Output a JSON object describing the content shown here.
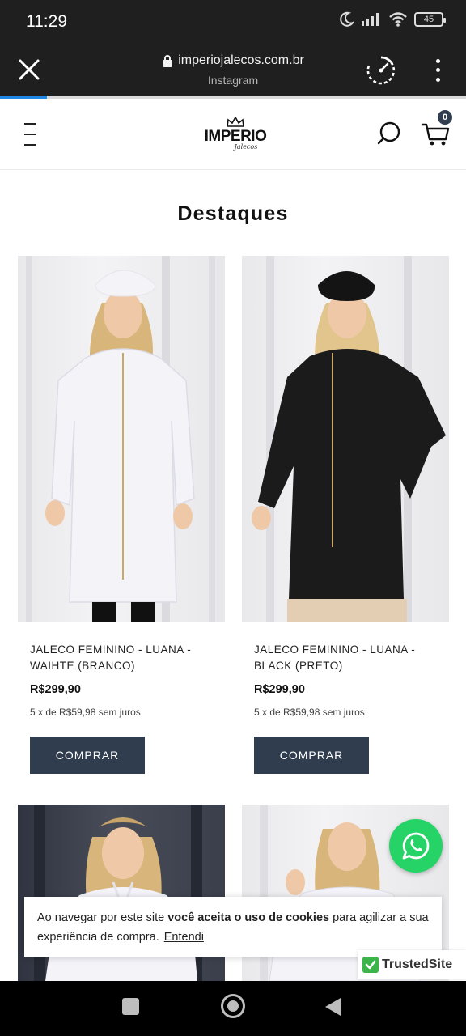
{
  "status_bar": {
    "time": "11:29",
    "battery": "45"
  },
  "browser": {
    "url": "imperiojalecos.com.br",
    "source": "Instagram",
    "progress_fraction": 0.1
  },
  "header": {
    "logo_text": "IMPERIO",
    "logo_script": "Jalecos",
    "cart_count": "0"
  },
  "section_title": "Destaques",
  "products": [
    {
      "name": "JALECO FEMININO - LUANA - WAIHTE (BRANCO)",
      "price": "R$299,90",
      "installments": "5 x de R$59,98 sem juros",
      "button": "COMPRAR",
      "coat_color": "#f3f3f8"
    },
    {
      "name": "JALECO FEMININO - LUANA - BLACK (PRETO)",
      "price": "R$299,90",
      "installments": "5 x de R$59,98 sem juros",
      "button": "COMPRAR",
      "coat_color": "#1b1b1b"
    }
  ],
  "cookie": {
    "text_1": "Ao navegar por este site ",
    "text_bold": "você aceita o uso de cookies",
    "text_2": " para agilizar a sua experiência de compra.",
    "link": "Entendi"
  },
  "trusted": {
    "label": "TrustedSite"
  },
  "colors": {
    "brand": "#2f3d4f",
    "whatsapp": "#25d366",
    "progress": "#1e88e5"
  }
}
